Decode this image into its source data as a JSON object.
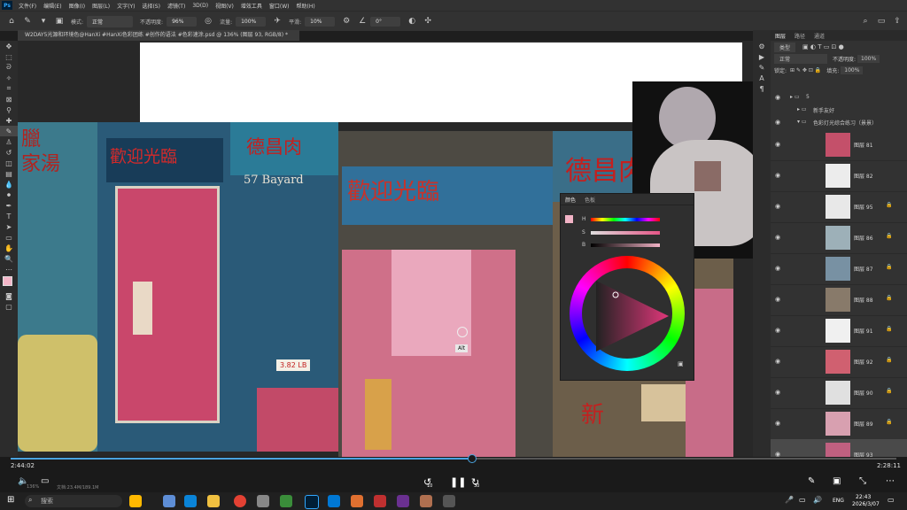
{
  "menubar": {
    "items": [
      "文件(F)",
      "编辑(E)",
      "图像(I)",
      "图层(L)",
      "文字(Y)",
      "选择(S)",
      "滤镜(T)",
      "3D(D)",
      "视图(V)",
      "增效工具",
      "窗口(W)",
      "帮助(H)"
    ]
  },
  "options": {
    "mode_label": "模式:",
    "mode_value": "正常",
    "opacity_label": "不透明度:",
    "opacity_value": "96%",
    "flow_label": "流量:",
    "flow_value": "100%",
    "smooth_label": "平滑:",
    "smooth_value": "10%",
    "angle_value": "0°"
  },
  "document": {
    "tab_title": "W2DAY5光源和环境色@HanXi #HanXi色彩团练 #创作的语法 #色彩速涂.psd @ 136% (图层 93, RGB/8) *"
  },
  "canvas": {
    "sign_left": "歡迎光臨",
    "sign_top": "德昌肉",
    "address": "57 Bayard",
    "sign_right": "新",
    "alt_label": "Alt",
    "price_text": "3.82 LB"
  },
  "color_panel": {
    "tabs": [
      "颜色",
      "色板"
    ],
    "h": "H",
    "s": "S",
    "b": "B"
  },
  "layers": {
    "tabs": [
      "图层",
      "路径",
      "通道"
    ],
    "kind_label": "类型",
    "blend_mode": "正常",
    "opacity_label": "不透明度:",
    "opacity_value": "100%",
    "lock_label": "锁定:",
    "fill_label": "填充:",
    "fill_value": "100%",
    "groups": [
      {
        "label": "5"
      },
      {
        "label": "新手友好"
      },
      {
        "label": "色彩灯光综合练习（景景）"
      }
    ],
    "items": [
      {
        "name": "图层 81",
        "locked": false
      },
      {
        "name": "图层 82",
        "locked": false
      },
      {
        "name": "图层 95",
        "locked": true
      },
      {
        "name": "图层 86",
        "locked": true
      },
      {
        "name": "图层 87",
        "locked": true
      },
      {
        "name": "图层 88",
        "locked": true
      },
      {
        "name": "图层 91",
        "locked": true
      },
      {
        "name": "图层 92",
        "locked": true
      },
      {
        "name": "图层 90",
        "locked": true
      },
      {
        "name": "图层 89",
        "locked": true
      },
      {
        "name": "图层 93",
        "locked": false
      }
    ]
  },
  "video": {
    "elapsed": "2:44:02",
    "remaining": "2:28:11",
    "skip_back": "10",
    "skip_forward": "30",
    "zoom_text": "136%",
    "doc_info": "文档:23.4M/189.1M",
    "progress": 0.52
  },
  "taskbar": {
    "search_placeholder": "搜索",
    "lang": "ENG",
    "time": "22:43",
    "date": "2026/3/07"
  }
}
